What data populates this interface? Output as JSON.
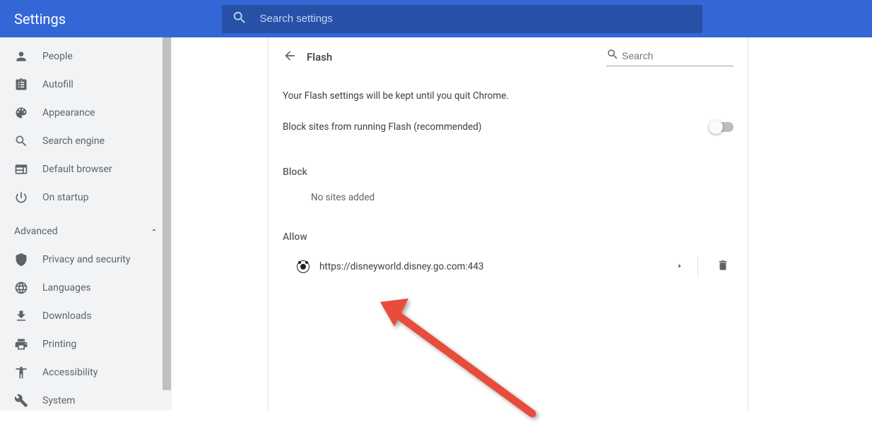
{
  "header": {
    "title": "Settings",
    "search_placeholder": "Search settings"
  },
  "sidebar": {
    "items": [
      {
        "icon": "person",
        "label": "People"
      },
      {
        "icon": "clipboard",
        "label": "Autofill"
      },
      {
        "icon": "palette",
        "label": "Appearance"
      },
      {
        "icon": "search",
        "label": "Search engine"
      },
      {
        "icon": "web",
        "label": "Default browser"
      },
      {
        "icon": "power",
        "label": "On startup"
      }
    ],
    "advanced_label": "Advanced",
    "advanced_expanded": true,
    "advanced_items": [
      {
        "icon": "shield",
        "label": "Privacy and security"
      },
      {
        "icon": "globe",
        "label": "Languages"
      },
      {
        "icon": "download",
        "label": "Downloads"
      },
      {
        "icon": "print",
        "label": "Printing"
      },
      {
        "icon": "accessibility",
        "label": "Accessibility"
      },
      {
        "icon": "wrench",
        "label": "System"
      }
    ]
  },
  "main": {
    "title": "Flash",
    "search_placeholder": "Search",
    "info_text": "Your Flash settings will be kept until you quit Chrome.",
    "toggle_label": "Block sites from running Flash (recommended)",
    "toggle_on": false,
    "block": {
      "header": "Block",
      "empty": "No sites added",
      "items": []
    },
    "allow": {
      "header": "Allow",
      "items": [
        {
          "url": "https://disneyworld.disney.go.com:443"
        }
      ]
    }
  },
  "colors": {
    "header_bg": "#3367d6",
    "annotation_arrow": "#e74c3c"
  }
}
